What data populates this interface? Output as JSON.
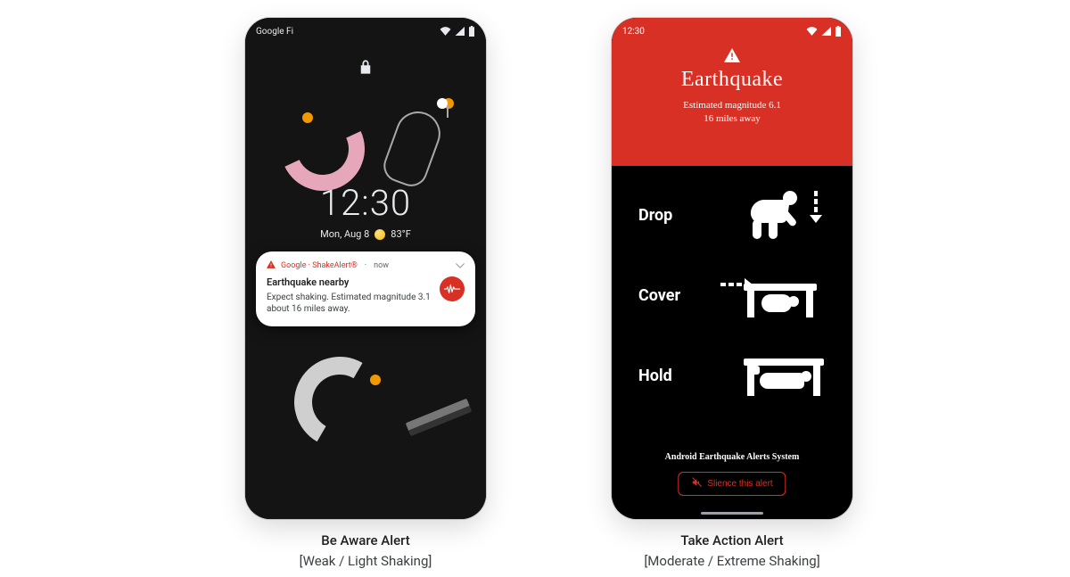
{
  "left": {
    "status": {
      "carrier": "Google Fi"
    },
    "clock": {
      "time": "12:30",
      "date": "Mon, Aug 8",
      "temp": "83°F"
    },
    "notification": {
      "source": "Google · ShakeAlert®",
      "time": "now",
      "title": "Earthquake nearby",
      "body": "Expect shaking. Estimated magnitude 3.1 about 16 miles away."
    },
    "caption": {
      "line1": "Be Aware Alert",
      "line2": "[Weak / Light Shaking]"
    }
  },
  "right": {
    "status": {
      "time": "12:30"
    },
    "header": {
      "title": "Earthquake",
      "magnitude": "Estimated magnitude 6.1",
      "distance": "16 miles away"
    },
    "steps": {
      "drop": "Drop",
      "cover": "Cover",
      "hold": "Hold"
    },
    "system_label": "Android Earthquake Alerts System",
    "silence": "Slience this alert",
    "caption": {
      "line1": "Take Action Alert",
      "line2": "[Moderate / Extreme Shaking]"
    }
  },
  "colors": {
    "alert_red": "#d93025"
  }
}
